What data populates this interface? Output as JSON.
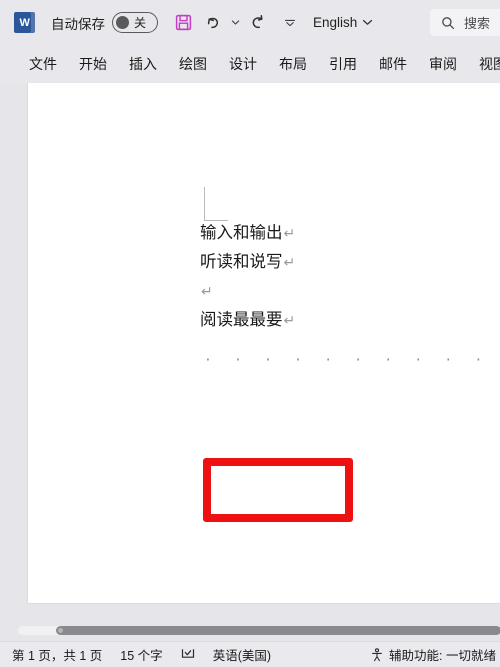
{
  "titlebar": {
    "app_icon": "word-icon",
    "autosave_label": "自动保存",
    "autosave_state": "关",
    "save_icon": "save-floppy-icon",
    "undo_icon": "undo-arrow-icon",
    "undo_dropdown_icon": "chevron-down-icon",
    "redo_icon": "redo-arrow-icon",
    "customize_qat_icon": "chevron-down-icon",
    "language": "English",
    "language_chevron_icon": "chevron-down-icon"
  },
  "search": {
    "icon": "search-icon",
    "placeholder": "搜索"
  },
  "ribbon": {
    "tabs": [
      {
        "label": "文件"
      },
      {
        "label": "开始"
      },
      {
        "label": "插入"
      },
      {
        "label": "绘图"
      },
      {
        "label": "设计"
      },
      {
        "label": "布局"
      },
      {
        "label": "引用"
      },
      {
        "label": "邮件"
      },
      {
        "label": "审阅"
      },
      {
        "label": "视图"
      }
    ]
  },
  "document": {
    "paragraph_mark": "↵",
    "lines": [
      {
        "text": "输入和输出",
        "mark": "↵"
      },
      {
        "text": "听读和说写",
        "mark": "↵"
      },
      {
        "text": "",
        "mark": "↵"
      },
      {
        "text": "阅读最最要",
        "mark": "↵"
      }
    ],
    "space_marks_line": {
      "dots": "· · · · · · · · · · · ·",
      "mark": "↵",
      "highlight_color": "#ee1111"
    }
  },
  "statusbar": {
    "page_info": "第 1 页，共 1 页",
    "word_count": "15 个字",
    "proofing_icon": "proofing-check-icon",
    "language": "英语(美国)",
    "accessibility_icon": "accessibility-icon",
    "accessibility_text": "辅助功能: 一切就绪"
  },
  "scrollbar": {
    "orientation": "horizontal"
  }
}
